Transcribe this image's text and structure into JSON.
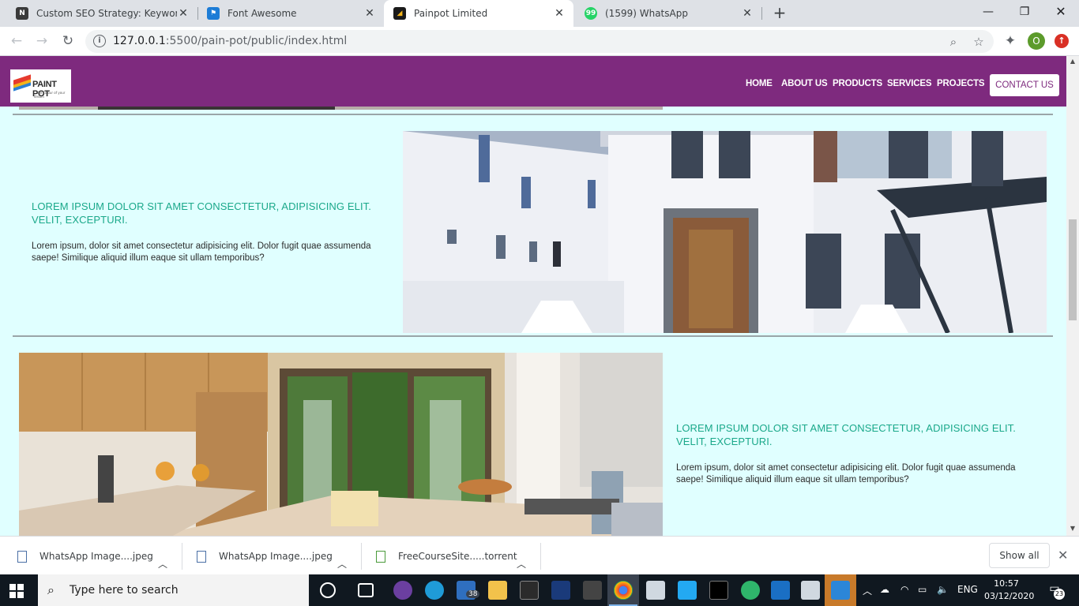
{
  "browser": {
    "tabs": [
      {
        "title": "Custom SEO Strategy: Keyword R",
        "favicon": "seo-favicon",
        "active": false
      },
      {
        "title": "Font Awesome",
        "favicon": "flag-favicon",
        "active": false
      },
      {
        "title": "Painpot Limited",
        "favicon": "painpot-favicon",
        "active": true
      },
      {
        "title": "(1599) WhatsApp",
        "favicon": "whatsapp-favicon",
        "active": false
      }
    ],
    "url_host": "127.0.0.1",
    "url_path": ":5500/pain-pot/public/index.html",
    "profile_initial": "O"
  },
  "site": {
    "logo_text": "PAINT POT",
    "logo_tagline": "...the colour of your dream",
    "nav": [
      "HOME",
      "ABOUT US",
      "PRODUCTS",
      "SERVICES",
      "PROJECTS"
    ],
    "contact_label": "CONTACT US",
    "accent": "#7e2a7e",
    "heading_color": "#1aa88a",
    "sections": [
      {
        "heading": "LOREM IPSUM DOLOR SIT AMET CONSECTETUR, ADIPISICING ELIT. VELIT, EXCEPTURI.",
        "body": "Lorem ipsum, dolor sit amet consectetur adipisicing elit. Dolor fugit quae assumenda saepe! Similique aliquid illum eaque sit ullam temporibus?",
        "image": "white-house-photo"
      },
      {
        "heading": "LOREM IPSUM DOLOR SIT AMET CONSECTETUR, ADIPISICING ELIT. VELIT, EXCEPTURI.",
        "body": "Lorem ipsum, dolor sit amet consectetur adipisicing elit. Dolor fugit quae assumenda saepe! Similique aliquid illum eaque sit ullam temporibus?",
        "image": "kitchen-photo"
      }
    ]
  },
  "downloads": {
    "items": [
      {
        "name": "WhatsApp Image....jpeg"
      },
      {
        "name": "WhatsApp Image....jpeg"
      },
      {
        "name": "FreeCourseSite.....torrent"
      }
    ],
    "show_all": "Show all"
  },
  "taskbar": {
    "search_placeholder": "Type here to search",
    "badge_count": "38",
    "language": "ENG",
    "time": "10:57",
    "date": "03/12/2020",
    "notification_count": "23"
  }
}
